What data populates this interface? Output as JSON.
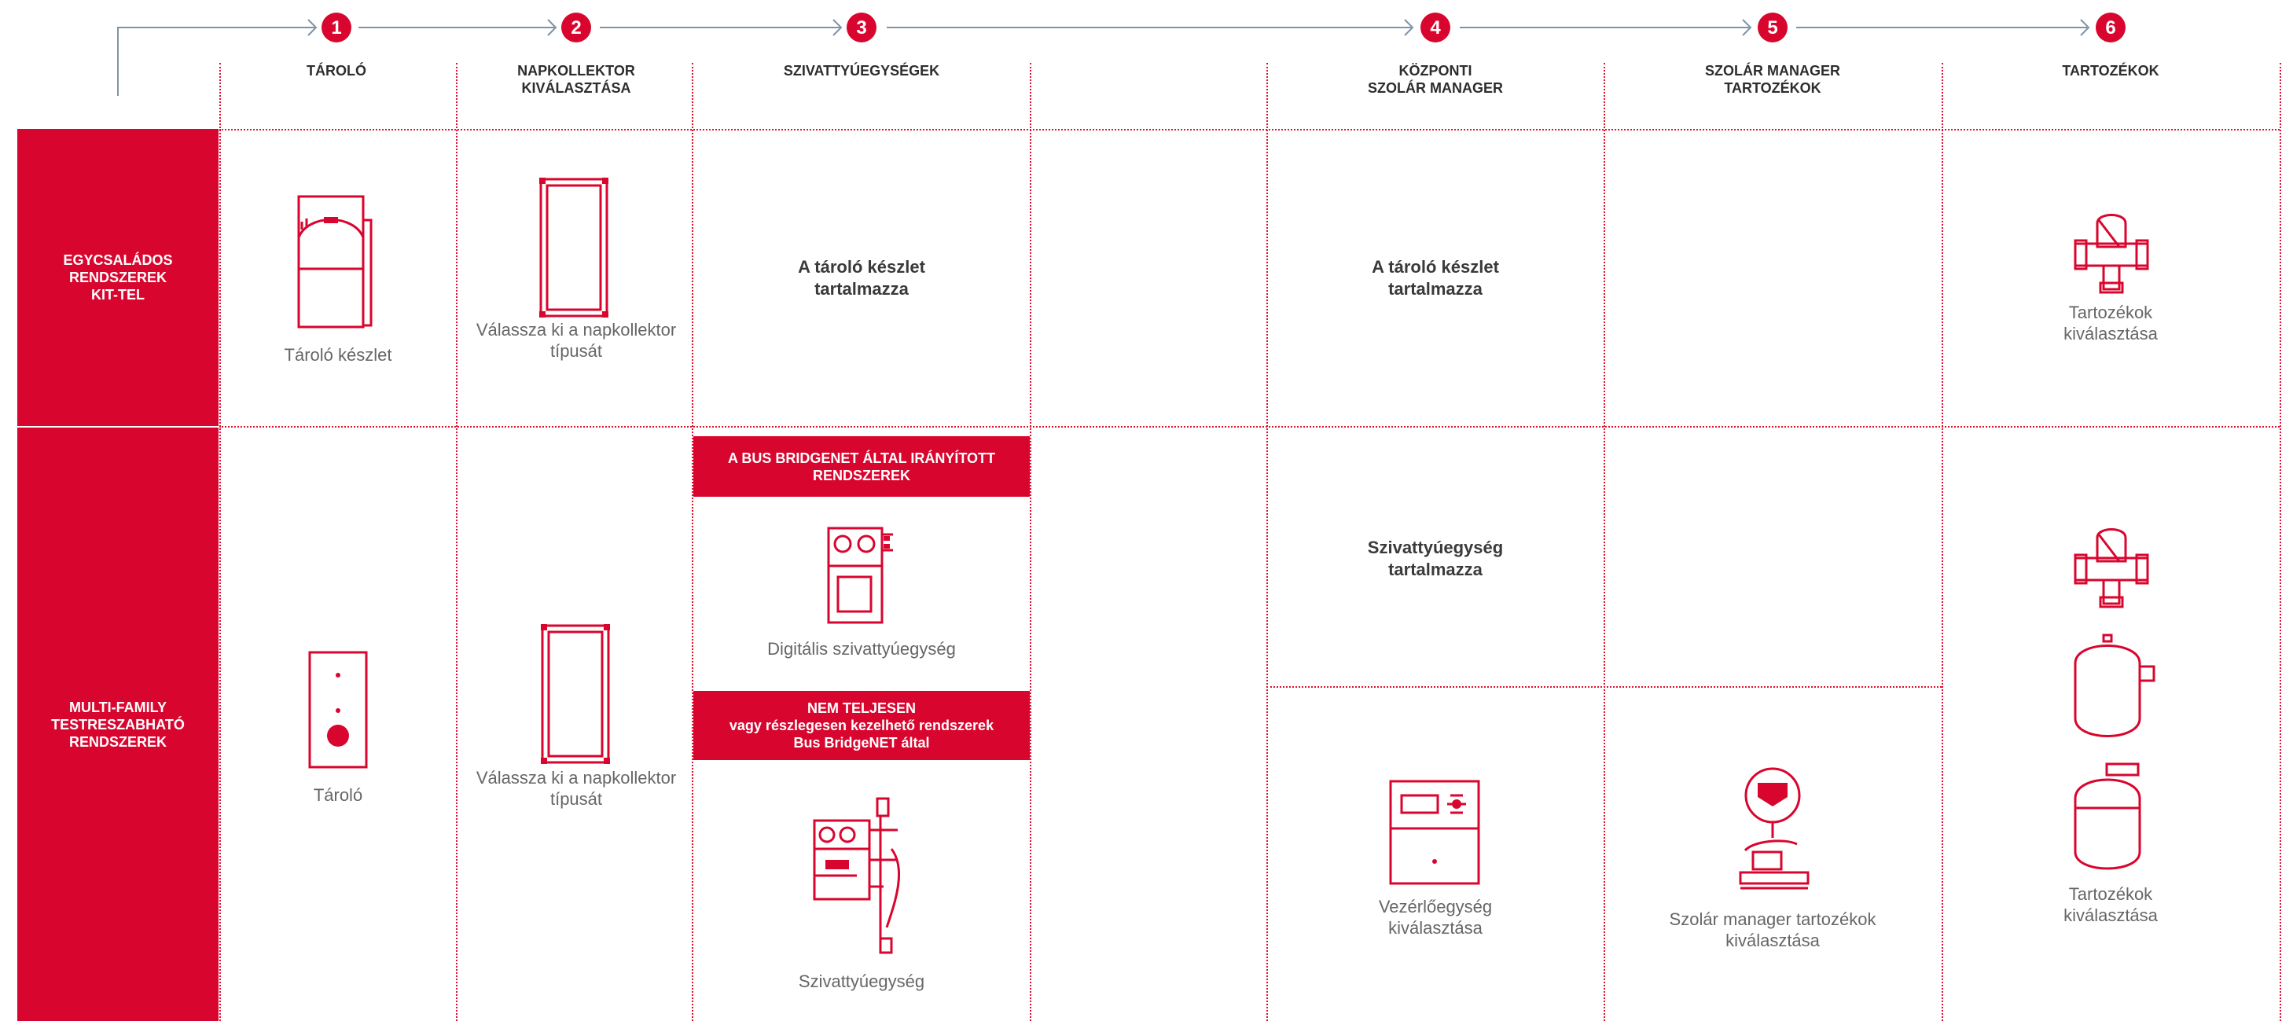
{
  "steps": [
    {
      "number": "1",
      "label": "TÁROLÓ"
    },
    {
      "number": "2",
      "label": "NAPKOLLEKTOR\nKIVÁLASZTÁSA"
    },
    {
      "number": "3",
      "label": "SZIVATTYÚEGYSÉGEK"
    },
    {
      "number": "4",
      "label": "KÖZPONTI\nSZOLÁR MANAGER"
    },
    {
      "number": "5",
      "label": "SZOLÁR MANAGER\nTARTOZÉKOK"
    },
    {
      "number": "6",
      "label": "TARTOZÉKOK"
    }
  ],
  "rows": {
    "single": "EGYCSALÁDOS\nRENDSZEREK\nKIT-TEL",
    "multi": "MULTI-FAMILY\nTESTRESZABHATÓ\nRENDSZEREK"
  },
  "single": {
    "storage_caption": "Tároló készlet",
    "collector_caption": "Válassza ki a napkollektor\ntípusát",
    "pump_included": "A tároló készlet\ntartalmazza",
    "manager_included": "A tároló készlet\ntartalmazza",
    "accessories_caption": "Tartozékok\nkiválasztása"
  },
  "multi": {
    "storage_caption": "Tároló",
    "collector_caption": "Válassza ki a napkollektor\ntípusát",
    "banner_bus": "A BUS BRIDGENET ÁLTAL IRÁNYÍTOTT\nRENDSZEREK",
    "digital_pump_caption": "Digitális szivattyúegység",
    "banner_partial": "NEM TELJESEN\nvagy részlegesen kezelhető rendszerek\nBus BridgeNET által",
    "pump_caption": "Szivattyúegység",
    "manager_included": "Szivattyúegység\ntartalmazza",
    "controller_caption": "Vezérlőegység\nkiválasztása",
    "manager_acc_caption": "Szolár manager tartozékok\nkiválasztása",
    "accessories_caption": "Tartozékok\nkiválasztása"
  },
  "colors": {
    "accent": "#d8062e",
    "connector": "#7d93a8"
  },
  "icons": [
    "storage-kit-icon",
    "solar-collector-icon",
    "valve-icon",
    "storage-tank-icon",
    "digital-pump-unit-icon",
    "pump-unit-icon",
    "controller-unit-icon",
    "solar-manager-accessory-icon",
    "expansion-vessel-icon"
  ]
}
